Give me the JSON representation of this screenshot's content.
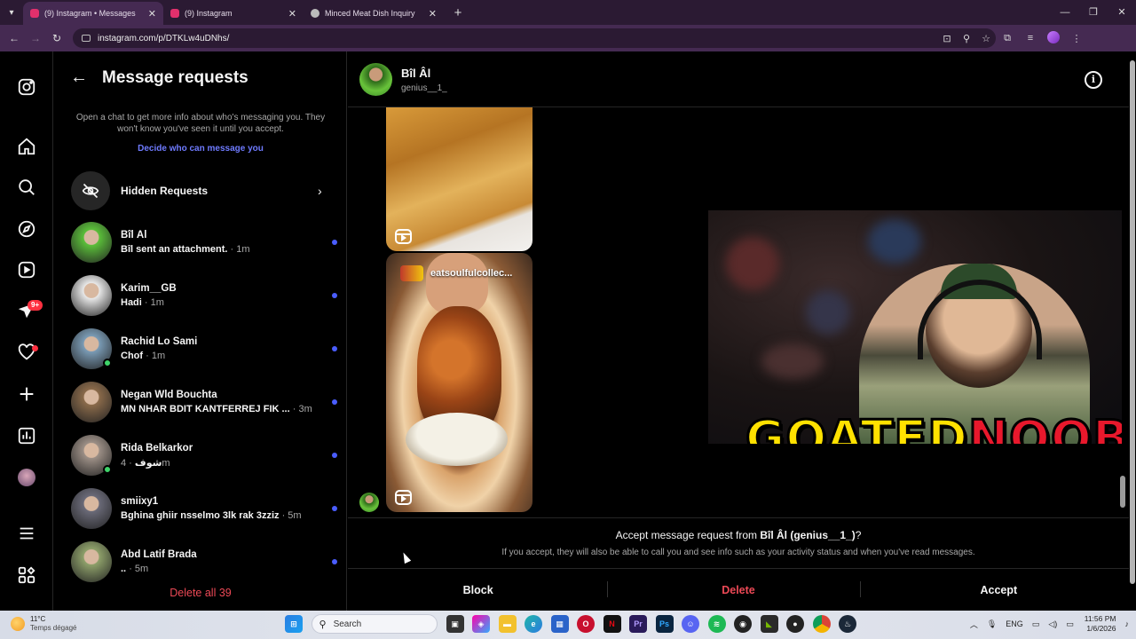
{
  "browser": {
    "tabs": [
      {
        "title": "(9) Instagram • Messages",
        "active": true,
        "favicon_color": "#e1306c"
      },
      {
        "title": "(9) Instagram",
        "active": false,
        "favicon_color": "#e1306c"
      },
      {
        "title": "Minced Meat Dish Inquiry",
        "active": false,
        "favicon_color": "#bbbbbb"
      }
    ],
    "url": "instagram.com/p/DTKLw4uDNhs/"
  },
  "sidebar_nav": {
    "items": [
      "instagram-logo",
      "home",
      "search",
      "explore",
      "reels",
      "messages",
      "notifications",
      "create",
      "dashboard",
      "profile",
      "more",
      "also-from-meta"
    ],
    "messages_badge": "9+"
  },
  "requests": {
    "title": "Message requests",
    "info": "Open a chat to get more info about who's messaging you. They won't know you've seen it until you accept.",
    "decide_link": "Decide who can message you",
    "hidden_label": "Hidden Requests",
    "conversations": [
      {
        "name": "Bîl Âl",
        "preview": "Bîl sent an attachment.",
        "time": "· 1m",
        "online": false,
        "avatar": "#5bbf3a"
      },
      {
        "name": "Karim__GB",
        "preview": "Hadi",
        "time": "· 1m",
        "online": false,
        "avatar": "#e8e8e8"
      },
      {
        "name": "Rachid Lo Sami",
        "preview": "Chof",
        "time": "· 1m",
        "online": true,
        "avatar": "#7a9bb5"
      },
      {
        "name": "Negan Wld Bouchta",
        "preview": "MN NHAR BDIT KANTFERREJ FIK ...",
        "time": "· 3m",
        "online": false,
        "avatar": "#8a6a4a"
      },
      {
        "name": "Rida Belkarkor",
        "preview": "شوف",
        "time": "· 4m",
        "online": true,
        "avatar": "#9c8f86"
      },
      {
        "name": "smiixy1",
        "preview": "Bghina ghiir nsselmo 3lk rak 3zziz",
        "time": "· 5m",
        "online": false,
        "avatar": "#6a6a78"
      },
      {
        "name": "Abd Latif Brada",
        "preview": "..",
        "time": "· 5m",
        "online": false,
        "avatar": "#8ea06a"
      }
    ],
    "delete_all": "Delete all 39"
  },
  "chat": {
    "name": "Bîl Âl",
    "username": "genius__1_",
    "reel_account": "eatsoulfulcollec...",
    "accept_prefix": "Accept message request from ",
    "accept_name": "Bîl Âl (genius__1_)",
    "accept_suffix": "?",
    "accept_sub": "If you accept, they will also be able to call you and see info such as your activity status and when you've read messages.",
    "block": "Block",
    "delete": "Delete",
    "accept": "Accept"
  },
  "overlay": {
    "logo_part1": "GOATED",
    "logo_part2": "NOOBIE"
  },
  "taskbar": {
    "temperature": "11°C",
    "weather": "Temps dégagé",
    "search_placeholder": "Search",
    "lang": "ENG",
    "time": "11:56 PM",
    "date": "1/6/2026"
  }
}
